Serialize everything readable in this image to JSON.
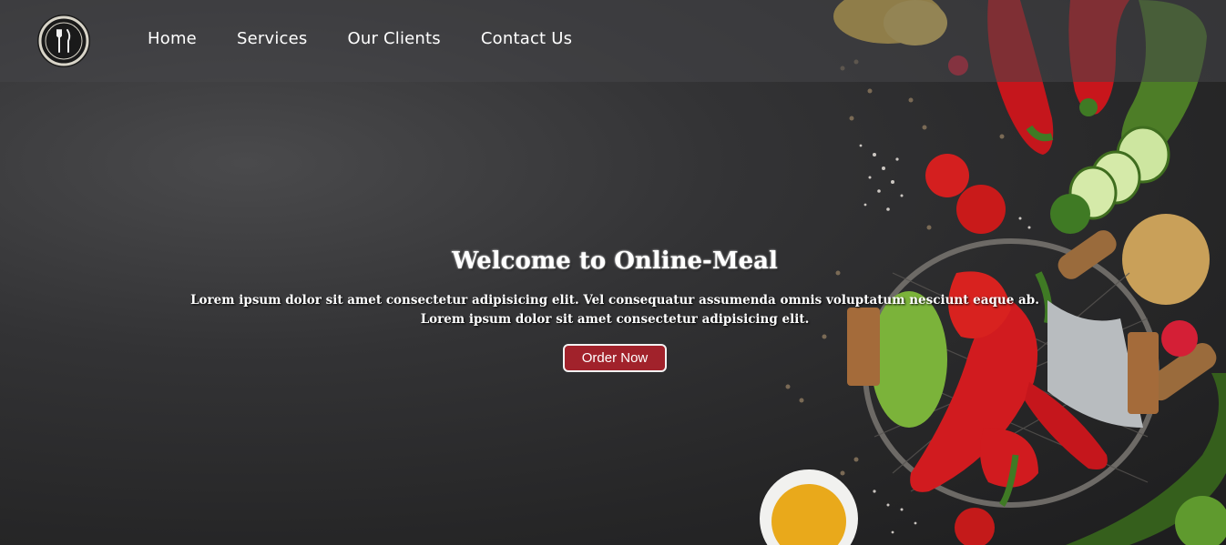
{
  "header": {
    "logo_icon": "fork-knife-icon",
    "nav": [
      {
        "label": "Home"
      },
      {
        "label": "Services"
      },
      {
        "label": "Our Clients"
      },
      {
        "label": "Contact Us"
      }
    ]
  },
  "hero": {
    "title": "Welcome to Online-Meal",
    "line1": "Lorem ipsum dolor sit amet consectetur adipisicing elit. Vel consequatur assumenda omnis voluptatum nesciunt eaque ab.",
    "line2": "Lorem ipsum dolor sit amet consectetur adipisicing elit.",
    "cta_label": "Order Now"
  },
  "colors": {
    "cta_bg": "#a1222b",
    "navbar_bg": "rgba(70,70,72,0.55)",
    "background": "#2a2a2b"
  }
}
